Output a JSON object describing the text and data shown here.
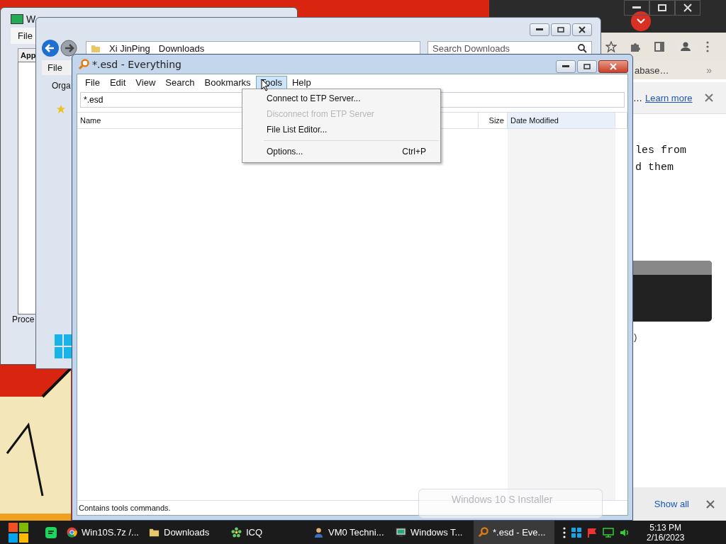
{
  "task_manager": {
    "title": "W",
    "menu": [
      "File"
    ],
    "tab": "App",
    "footer_text": "Proce"
  },
  "explorer": {
    "breadcrumb": [
      "Xi JinPing",
      "Downloads"
    ],
    "search": {
      "placeholder": "Search Downloads"
    },
    "menu": [
      "File"
    ],
    "toolbar_text": "Orga"
  },
  "browser": {
    "bookmark": "abase…",
    "overflow": "»",
    "infobar": {
      "text": "…",
      "link": "Learn more"
    },
    "page_lines": [
      "les from",
      "d them"
    ],
    "fragment": ")",
    "download_bar": {
      "button": "Show all"
    }
  },
  "everything": {
    "title": "*.esd - Everything",
    "menu": [
      {
        "label": "File",
        "selected": false
      },
      {
        "label": "Edit",
        "selected": false
      },
      {
        "label": "View",
        "selected": false
      },
      {
        "label": "Search",
        "selected": false
      },
      {
        "label": "Bookmarks",
        "selected": false
      },
      {
        "label": "Tools",
        "selected": true
      },
      {
        "label": "Help",
        "selected": false
      }
    ],
    "search": {
      "value": "*.esd"
    },
    "columns": [
      "Name",
      "Size",
      "Date Modified"
    ],
    "dropdown": [
      {
        "kind": "item",
        "label": "Connect to ETP Server...",
        "disabled": false
      },
      {
        "kind": "item",
        "label": "Disconnect from ETP Server",
        "disabled": true
      },
      {
        "kind": "item",
        "label": "File List Editor...",
        "disabled": false
      },
      {
        "kind": "separator"
      },
      {
        "kind": "item",
        "label": "Options...",
        "shortcut": "Ctrl+P",
        "disabled": false
      }
    ],
    "status": "Contains tools commands."
  },
  "notification": {
    "title": "Windows 10 S Installer"
  },
  "taskbar": {
    "tasks": [
      {
        "kind": "chrome",
        "label": "Win10S.7z /...",
        "selected": false
      },
      {
        "kind": "folder",
        "label": "Downloads",
        "selected": false
      },
      {
        "kind": "icq",
        "label": "ICQ",
        "selected": false
      },
      {
        "kind": "person",
        "label": "VM0 Techni...",
        "selected": false
      },
      {
        "kind": "monitor",
        "label": "Windows T...",
        "selected": false
      },
      {
        "kind": "search",
        "label": "*.esd - Eve...",
        "selected": true
      }
    ],
    "clock": {
      "time": "5:13 PM",
      "date": "2/16/2023"
    }
  }
}
